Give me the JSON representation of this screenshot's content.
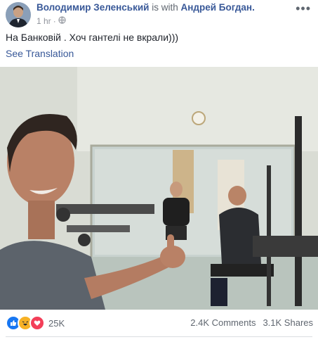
{
  "post": {
    "author": "Володимир Зеленський",
    "with_text": "is with",
    "tagged": "Андрей Богдан.",
    "time": "1 hr",
    "audience_icon": "globe-icon",
    "text": "На Банковій . Хоч гантелі не вкрали)))",
    "see_translation": "See Translation"
  },
  "footer": {
    "reaction_icons": [
      "like-icon",
      "haha-icon",
      "love-icon"
    ],
    "reaction_count": "25K",
    "comments": "2.4K Comments",
    "shares": "3.1K Shares"
  },
  "colors": {
    "link": "#385898",
    "like": "#1877f2",
    "haha": "#f7b125",
    "love": "#f33e58"
  }
}
